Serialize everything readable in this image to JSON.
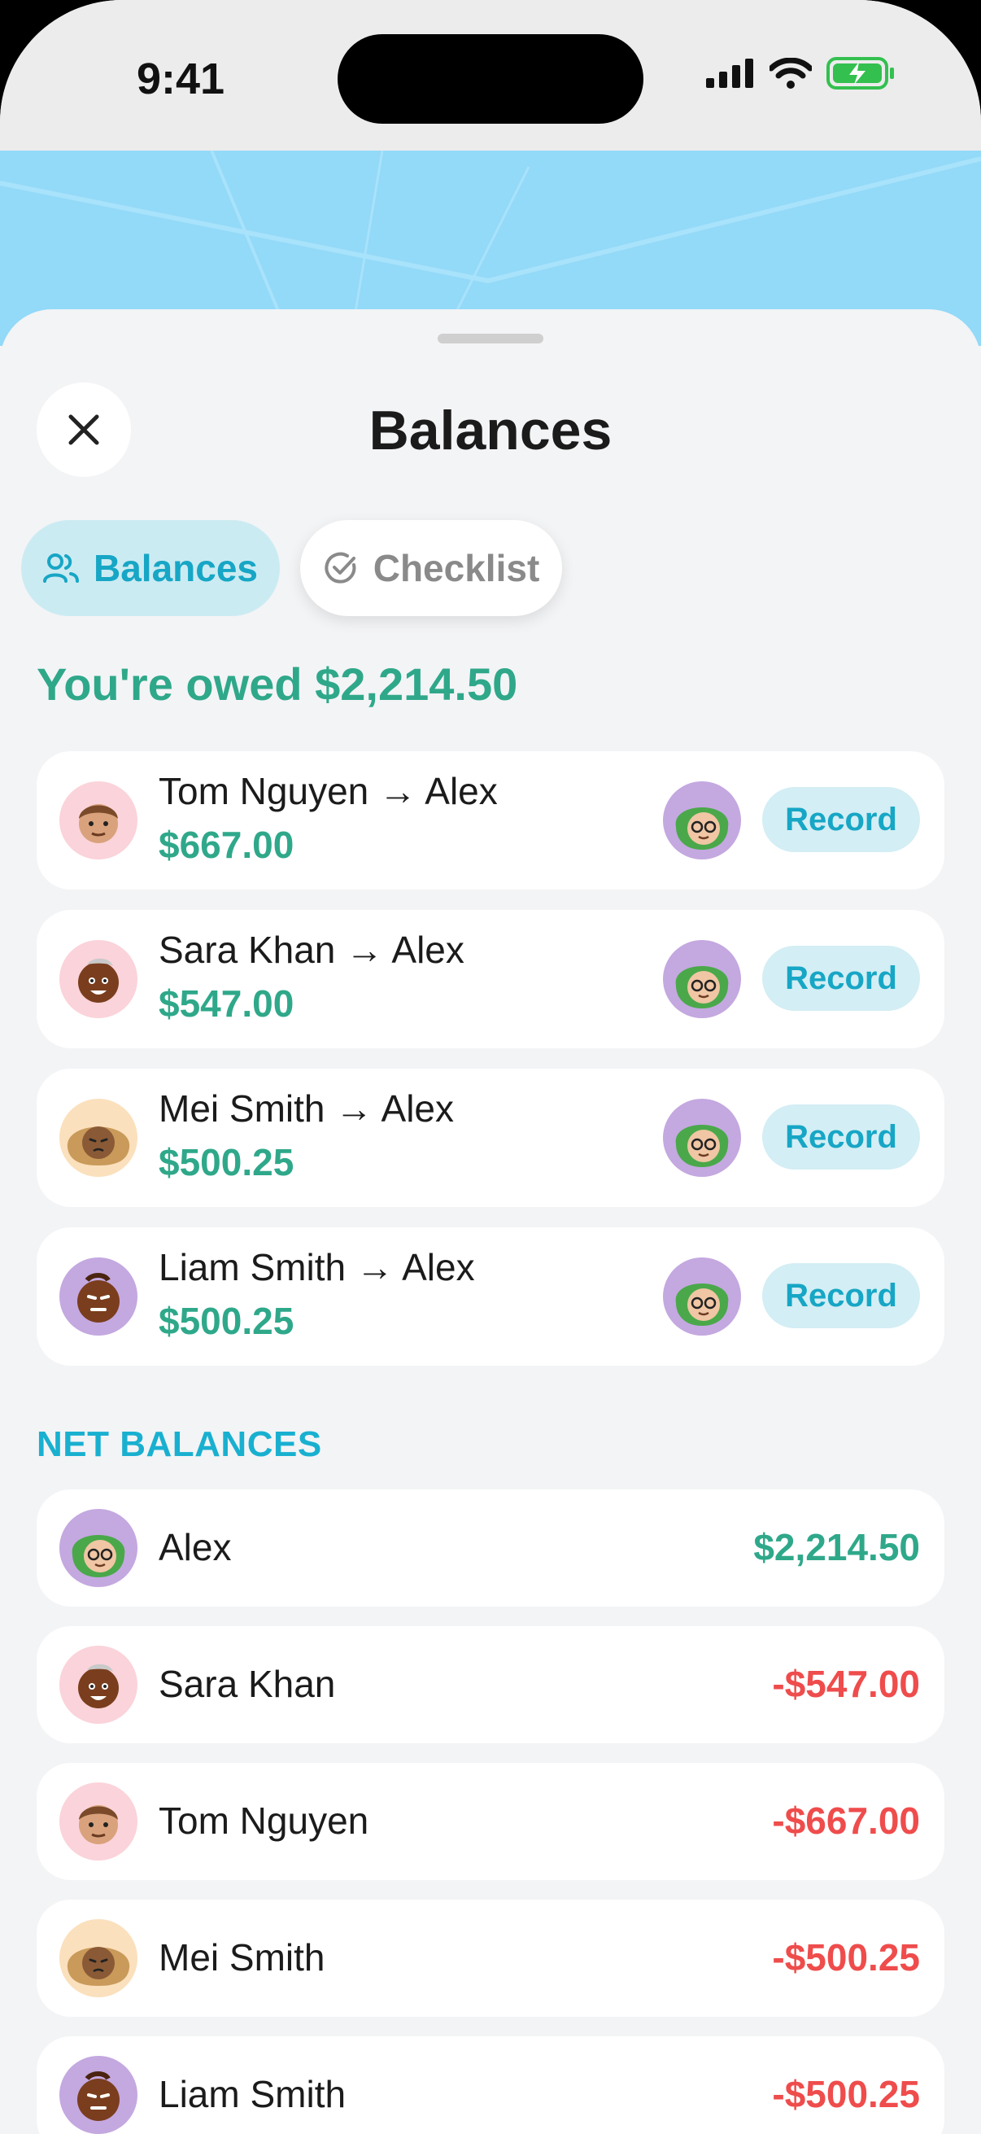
{
  "status_bar": {
    "time": "9:41"
  },
  "sheet": {
    "title": "Balances",
    "tabs": [
      {
        "label": "Balances",
        "icon": "people-icon",
        "active": true
      },
      {
        "label": "Checklist",
        "icon": "check-circle-icon",
        "active": false
      }
    ],
    "summary": "You're owed $2,214.50",
    "debts": [
      {
        "title": "Tom Nguyen → Alex",
        "amount": "$667.00",
        "action": "Record"
      },
      {
        "title": "Sara Khan → Alex",
        "amount": "$547.00",
        "action": "Record"
      },
      {
        "title": "Mei Smith → Alex",
        "amount": "$500.25",
        "action": "Record"
      },
      {
        "title": "Liam Smith → Alex",
        "amount": "$500.25",
        "action": "Record"
      }
    ],
    "net_header": "NET BALANCES",
    "net_balances": [
      {
        "name": "Alex",
        "amount": "$2,214.50"
      },
      {
        "name": "Sara Khan",
        "amount": "-$547.00"
      },
      {
        "name": "Tom Nguyen",
        "amount": "-$667.00"
      },
      {
        "name": "Mei Smith",
        "amount": "-$500.25"
      },
      {
        "name": "Liam Smith",
        "amount": "-$500.25"
      }
    ]
  },
  "colors": {
    "accent": "#17a6c5",
    "positive": "#2fa88a",
    "negative": "#ef4c4c",
    "map_water": "#93d9f8"
  }
}
